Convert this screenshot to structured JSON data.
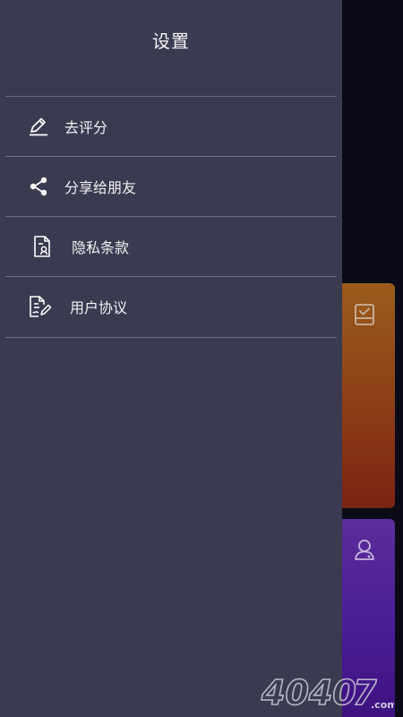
{
  "drawer": {
    "title": "设置",
    "items": [
      {
        "label": "去评分",
        "icon": "edit-icon"
      },
      {
        "label": "分享给朋友",
        "icon": "share-icon"
      },
      {
        "label": "隐私条款",
        "icon": "privacy-doc-icon"
      },
      {
        "label": "用户协议",
        "icon": "agreement-doc-icon"
      }
    ]
  },
  "background_app": {
    "cards": [
      {
        "icon": "checklist-icon",
        "color": "#8b3a16"
      },
      {
        "icon": "user-icon",
        "color": "#4a1c95"
      }
    ]
  },
  "watermark": {
    "text": "4040",
    "suffix": "7",
    "domain": ".com"
  },
  "colors": {
    "drawer_bg": "#3a3a50",
    "backdrop": "#0b0b17",
    "divider": "#6d6d84"
  }
}
